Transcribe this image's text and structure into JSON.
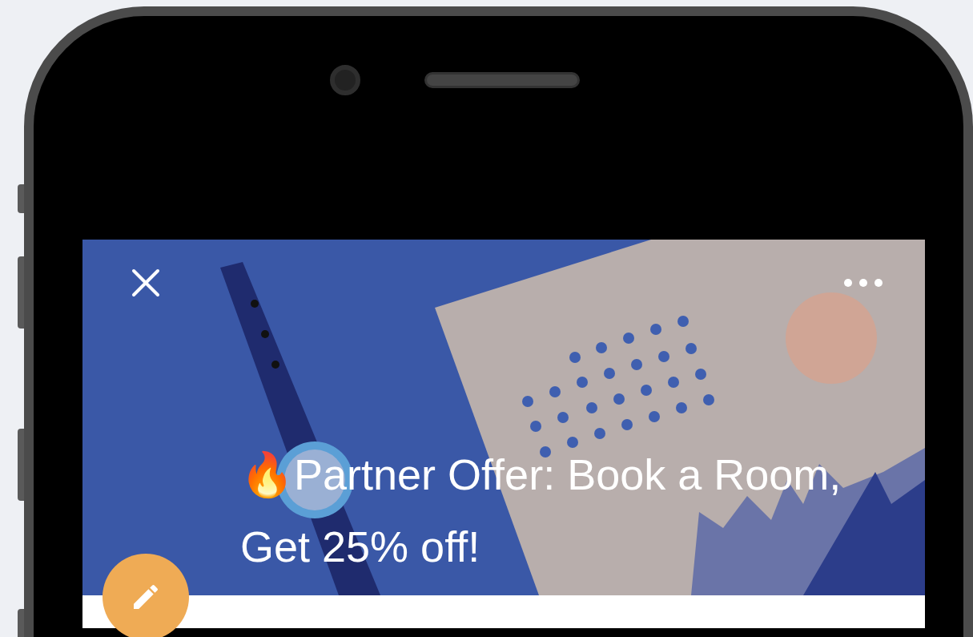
{
  "offer": {
    "title": "🔥Partner Offer: Book a Room, Get 25% off!"
  }
}
